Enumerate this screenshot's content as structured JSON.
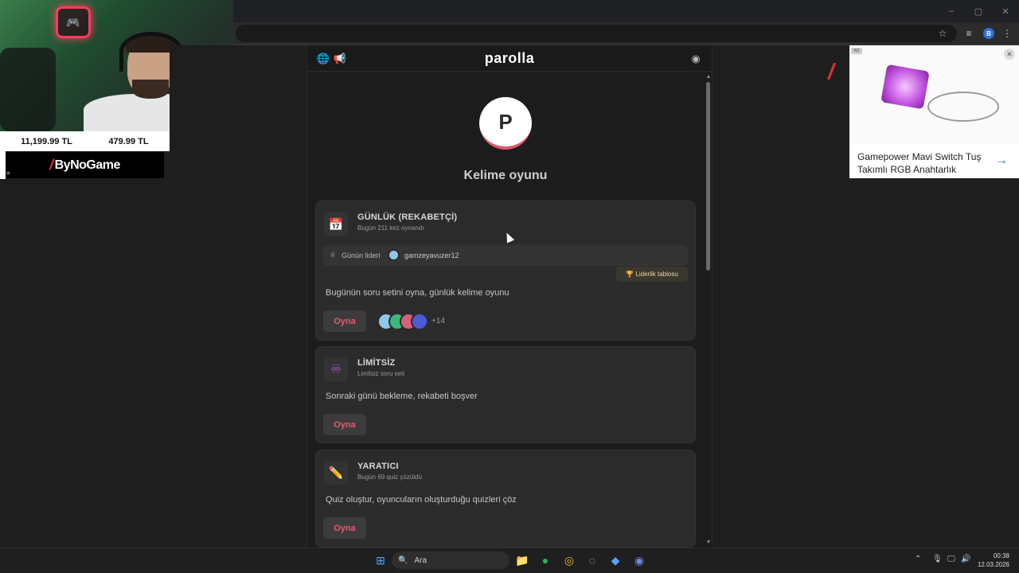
{
  "browser": {
    "window_controls": [
      "–",
      "▢",
      "✕"
    ],
    "profile_initial": "B"
  },
  "stream_overlay": {
    "price_left": "11,199.99 TL",
    "price_right": "479.99 TL",
    "sponsor_brand": "ByNoGame",
    "corner_mark": "="
  },
  "app": {
    "title": "parolla",
    "logo_letter": "P",
    "subtitle": "Kelime oyunu",
    "cards": [
      {
        "icon": "📅",
        "title": "GÜNLÜK (REKABETÇİ)",
        "sub": "Bugün 211 kez oynandı",
        "leader_label": "Günün lideri",
        "leader_name": "gamzeyavuzer12",
        "leaderboard_button": "🏆 Liderlik tablosu",
        "desc": "Bugünün soru setini oyna, günlük kelime oyunu",
        "play": "Oyna",
        "players_more": "+14"
      },
      {
        "icon": "♾",
        "title": "LİMİTSİZ",
        "sub": "Limitsiz soru seti",
        "desc": "Sonraki günü bekleme, rekabeti boşver",
        "play": "Oyna"
      },
      {
        "icon": "✏️",
        "title": "YARATICI",
        "sub": "Bugün 69 quiz çözüldü",
        "desc": "Quiz oluştur, oyuncuların oluşturduğu quizleri çöz",
        "play": "Oyna"
      }
    ]
  },
  "ad": {
    "badge": "AD",
    "title": "Gamepower Mavi Switch Tuş Takımlı RGB Anahtarlık",
    "arrow": "→"
  },
  "taskbar": {
    "search_placeholder": "Ara",
    "time": "00:38",
    "date": "12.03.2026"
  },
  "colors": {
    "accent": "#e45a72",
    "logo_ring": "#e0556d",
    "card_bg": "#2b2b2b",
    "page_bg": "#1c1c1c"
  }
}
